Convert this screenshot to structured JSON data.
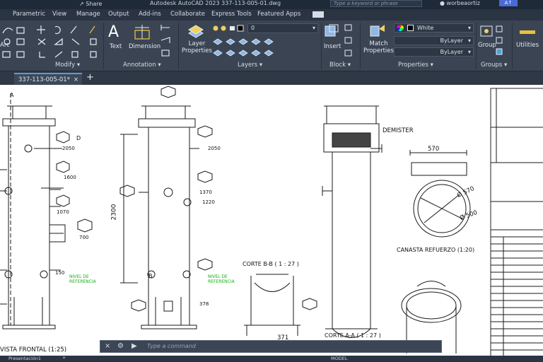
{
  "titlebar": {
    "share_label": "Share",
    "title": "Autodesk AutoCAD 2023    337-113-005-01.dwg",
    "search_placeholder": "Type a keyword or phrase",
    "username": "worbeaortiz",
    "help_label": "A↑"
  },
  "ribbon_tabs": [
    "Parametric",
    "View",
    "Manage",
    "Output",
    "Add-ins",
    "Collaborate",
    "Express Tools",
    "Featured Apps"
  ],
  "ribbon": {
    "modify": {
      "title": "Modify",
      "left_label": "Arc"
    },
    "annotation": {
      "title": "Annotation",
      "text_label": "Text",
      "dimension_label": "Dimension"
    },
    "layers": {
      "title": "Layers",
      "layer_properties_label": "Layer\nProperties",
      "current_layer": "0"
    },
    "block": {
      "title": "Block",
      "insert_label": "Insert"
    },
    "properties": {
      "title": "Properties",
      "match_label": "Match\nProperties",
      "color": "White",
      "linetype": "ByLayer",
      "lineweight": "ByLayer"
    },
    "groups": {
      "title": "Groups",
      "group_label": "Group"
    },
    "utilities": {
      "title": "Utilities"
    }
  },
  "document_tab": {
    "name": "337-113-005-01*"
  },
  "drawing": {
    "labels": {
      "a_top": "A",
      "d_mark": "D",
      "b_mark": "B",
      "dim_2050_left": "2050",
      "dim_1600": "1600",
      "dim_1070": "1070",
      "dim_700": "700",
      "dim_150": "150",
      "dim_2050_mid": "2050",
      "dim_1370": "1370",
      "dim_1220": "1220",
      "dim_2300": "2300",
      "dim_378": "378",
      "demister": "DEMISTER",
      "dim_570_top": "570",
      "dim_570_circle": "Ø 570",
      "dim_500_circle": "Ø 500",
      "canasta": "CANASTA REFUERZO (1:20)",
      "corte_bb": "CORTE B-B ( 1 : 27 )",
      "corte_aa": "CORTE A-A ( 1 : 27 )",
      "dim_371": "371",
      "vista_frontal": "VISTA FRONTAL (1:25)",
      "nivel_left": "NIVEL DE\nREFERENCIA",
      "nivel_mid": "NIVEL DE\nREFERENCIA"
    }
  },
  "command_line": {
    "placeholder": "Type a command"
  },
  "statusbar": {
    "layout_tab": "Presentación1",
    "model_label": "MODEL"
  }
}
